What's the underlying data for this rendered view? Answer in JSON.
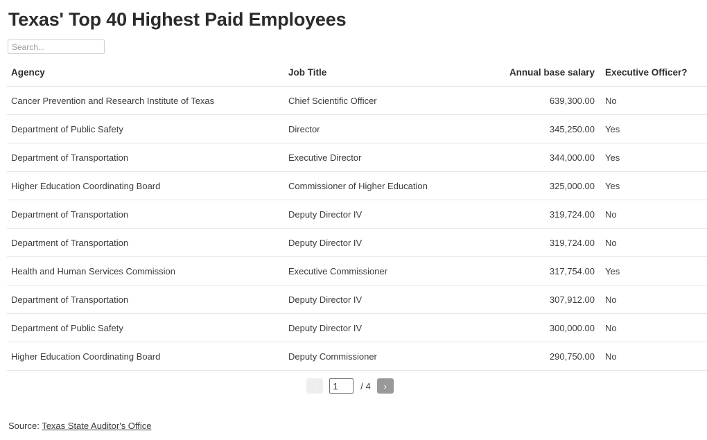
{
  "header": {
    "title": "Texas' Top 40 Highest Paid Employees"
  },
  "search": {
    "placeholder": "Search...",
    "value": ""
  },
  "table": {
    "columns": [
      "Agency",
      "Job Title",
      "Annual base salary",
      "Executive Officer?"
    ],
    "rows": [
      {
        "agency": "Cancer Prevention and Research Institute of Texas",
        "job_title": "Chief Scientific Officer",
        "salary": "639,300.00",
        "executive_officer": "No"
      },
      {
        "agency": "Department of Public Safety",
        "job_title": "Director",
        "salary": "345,250.00",
        "executive_officer": "Yes"
      },
      {
        "agency": "Department of Transportation",
        "job_title": "Executive Director",
        "salary": "344,000.00",
        "executive_officer": "Yes"
      },
      {
        "agency": "Higher Education Coordinating Board",
        "job_title": "Commissioner of Higher Education",
        "salary": "325,000.00",
        "executive_officer": "Yes"
      },
      {
        "agency": "Department of Transportation",
        "job_title": "Deputy Director IV",
        "salary": "319,724.00",
        "executive_officer": "No"
      },
      {
        "agency": "Department of Transportation",
        "job_title": "Deputy Director IV",
        "salary": "319,724.00",
        "executive_officer": "No"
      },
      {
        "agency": "Health and Human Services Commission",
        "job_title": "Executive Commissioner",
        "salary": "317,754.00",
        "executive_officer": "Yes"
      },
      {
        "agency": "Department of Transportation",
        "job_title": "Deputy Director IV",
        "salary": "307,912.00",
        "executive_officer": "No"
      },
      {
        "agency": "Department of Public Safety",
        "job_title": "Deputy Director IV",
        "salary": "300,000.00",
        "executive_officer": "No"
      },
      {
        "agency": "Higher Education Coordinating Board",
        "job_title": "Deputy Commissioner",
        "salary": "290,750.00",
        "executive_officer": "No"
      }
    ]
  },
  "pagination": {
    "prev_label": "‹",
    "next_label": "›",
    "current_page": "1",
    "total_pages_label": "/ 4",
    "total_pages": 4
  },
  "footer": {
    "source_prefix": "Source:",
    "source_link_text": "Texas State Auditor's Office"
  },
  "colors": {
    "title": "#2b2b2b",
    "body_text": "#3a3a3a",
    "row_border": "#e6e6e6",
    "header_border": "#e2e2e2",
    "prev_button_bg": "#eeeeee",
    "next_button_bg": "#999999",
    "input_border": "#cfcfcf",
    "placeholder": "#9b9b9b"
  }
}
